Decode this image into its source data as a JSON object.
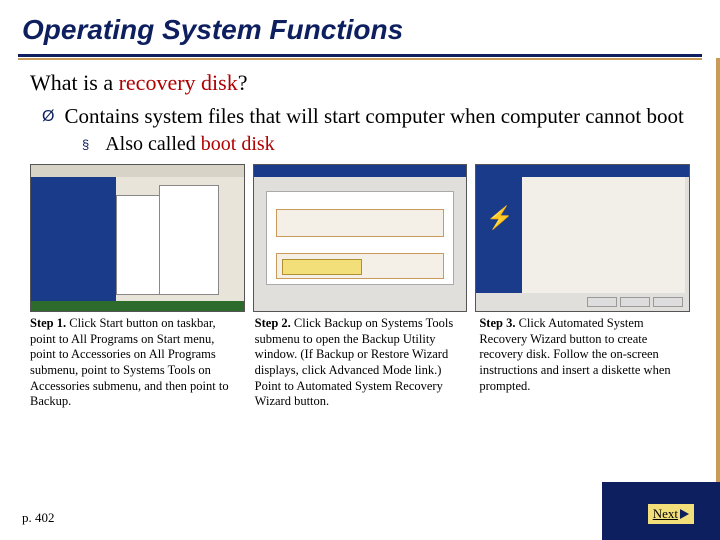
{
  "title": "Operating System Functions",
  "question_prefix": "What is a ",
  "question_highlight": "recovery disk",
  "question_suffix": "?",
  "bullet_main": "Contains system files that will start computer when computer cannot boot",
  "sub_prefix": "Also called ",
  "sub_highlight": "boot disk",
  "steps": [
    {
      "label": "Step 1.",
      "text": " Click Start button on taskbar, point to All Programs on Start menu, point to Accessories on All Programs submenu, point to Systems Tools on Accessories submenu, and then point to Backup."
    },
    {
      "label": "Step 2.",
      "text": " Click Backup on Systems Tools submenu to open the Backup Utility window. (If Backup or Restore Wizard displays, click Advanced Mode link.) Point to Automated System Recovery Wizard button."
    },
    {
      "label": "Step 3.",
      "text": " Click Automated System Recovery Wizard button to create recovery disk. Follow the on-screen instructions and insert a diskette when prompted."
    }
  ],
  "page_ref": "p. 402",
  "next_label": "Next"
}
